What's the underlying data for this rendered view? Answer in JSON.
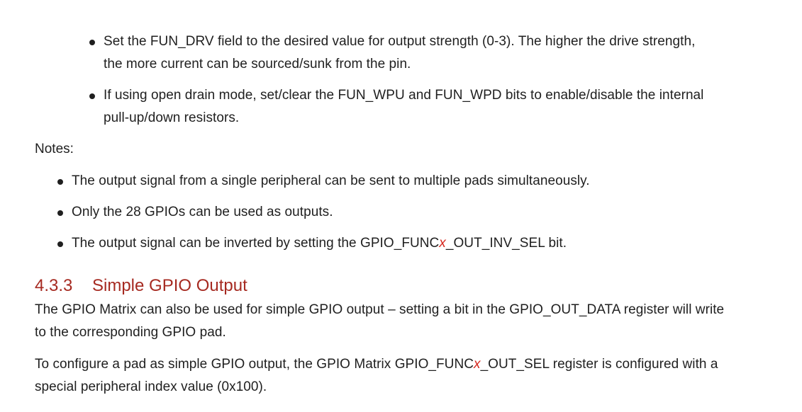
{
  "sub_bullets": [
    {
      "lines": [
        "Set the FUN_DRV field to the desired value for output strength (0-3). The higher the drive strength,",
        "the more current can be sourced/sunk from the pin."
      ]
    },
    {
      "lines": [
        "If using open drain mode, set/clear the FUN_WPU and FUN_WPD bits to enable/disable the internal",
        "pull-up/down resistors."
      ]
    }
  ],
  "notes_label": "Notes:",
  "notes": [
    "The output signal from a single peripheral can be sent to multiple pads simultaneously.",
    "Only the 28 GPIOs can be used as outputs.",
    {
      "before": "The output signal can be inverted by setting the GPIO_FUNC",
      "x": "x",
      "after": "_OUT_INV_SEL bit."
    }
  ],
  "section": {
    "number": "4.3.3",
    "title": "Simple GPIO Output"
  },
  "paragraph1": [
    "The GPIO Matrix can also be used for simple GPIO output – setting a bit in the GPIO_OUT_DATA register will write",
    "to the corresponding GPIO pad."
  ],
  "paragraph2": {
    "line1_before": "To configure a pad as simple GPIO output, the GPIO Matrix GPIO_FUNC",
    "line1_x": "x",
    "line1_after": "_OUT_SEL register is configured with a",
    "line2": "special peripheral index value (0x100)."
  },
  "colors": {
    "text": "#1f1f1f",
    "heading": "#a62a21",
    "variable": "#d6281f"
  }
}
